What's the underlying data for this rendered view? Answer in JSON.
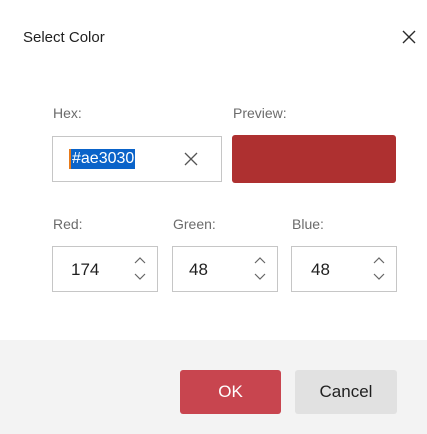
{
  "dialog": {
    "title": "Select Color",
    "hex_label": "Hex:",
    "hex_value": "#ae3030",
    "preview_label": "Preview:",
    "preview_color": "#ae3030",
    "red": {
      "label": "Red:",
      "value": "174"
    },
    "green": {
      "label": "Green:",
      "value": "48"
    },
    "blue": {
      "label": "Blue:",
      "value": "48"
    },
    "ok_label": "OK",
    "cancel_label": "Cancel"
  },
  "icons": {
    "close": "close-icon",
    "clear": "clear-icon",
    "increment": "chevron-up-icon",
    "decrement": "chevron-down-icon"
  },
  "colors": {
    "ok_button": "#c8454f",
    "selection": "#0a63c9",
    "footer": "#f3f3f3"
  }
}
